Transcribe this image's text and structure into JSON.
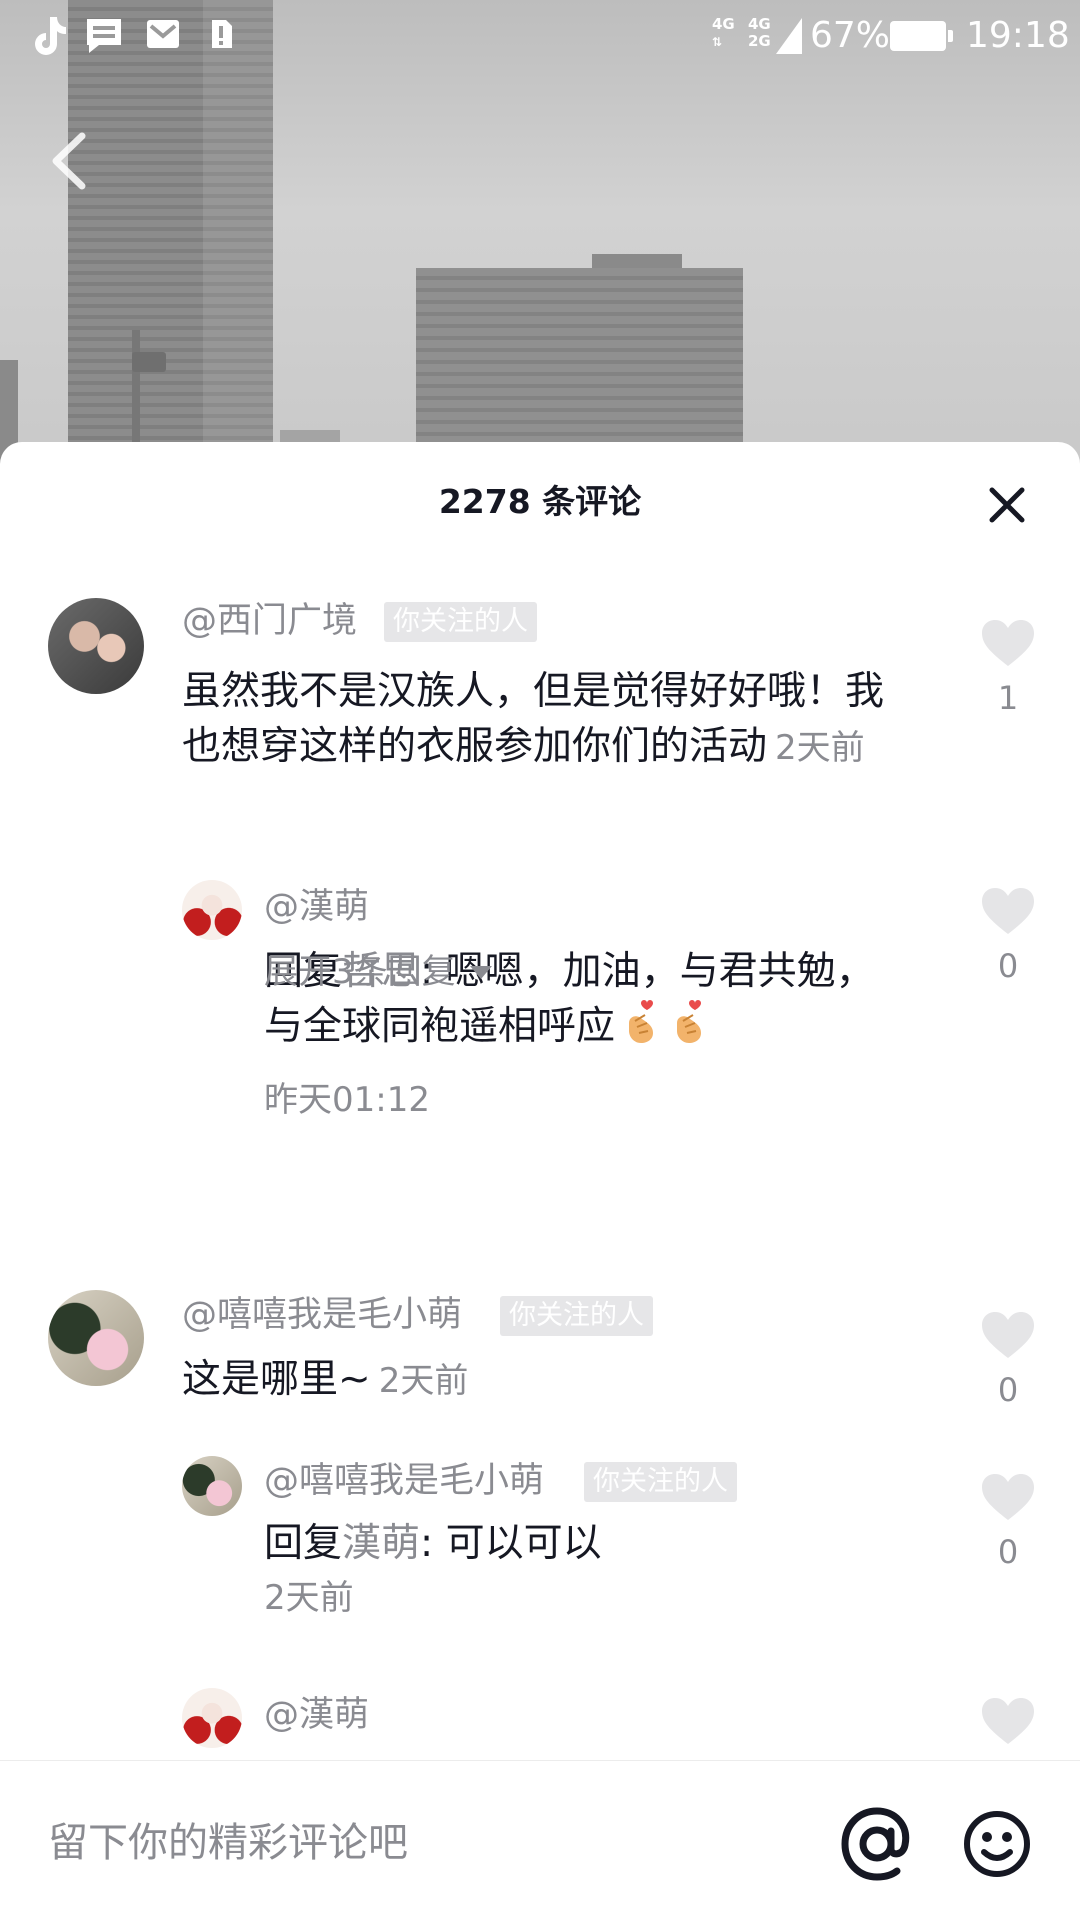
{
  "status_bar": {
    "network_1": "4G",
    "network_2": "4G",
    "network_2b": "2G",
    "battery": "67%",
    "time": "19:18"
  },
  "sheet": {
    "title": "2278 条评论"
  },
  "comments": [
    {
      "username": "@西门广境",
      "tag": "你关注的人",
      "text": "虽然我不是汉族人，但是觉得好好哦！我也想穿这样的衣服参加你们的活动",
      "time": "2天前",
      "likes": "1",
      "replies": [
        {
          "username": "@漢萌",
          "reply_prefix": "回复",
          "reply_target": "哲思",
          "text": ": 嗯嗯，加油，与君共勉，与全球同袍遥相呼应",
          "time": "昨天01:12",
          "likes": "0"
        }
      ],
      "expand_label": "展开3条回复"
    },
    {
      "username": "@嘻嘻我是毛小萌",
      "tag": "你关注的人",
      "text": "这是哪里~",
      "time": "2天前",
      "likes": "0",
      "replies": [
        {
          "username": "@嘻嘻我是毛小萌",
          "tag": "你关注的人",
          "reply_prefix": "回复",
          "reply_target": "漢萌",
          "text": ": 可以可以",
          "time": "2天前",
          "likes": "0"
        },
        {
          "username": "@漢萌"
        }
      ]
    }
  ],
  "input": {
    "placeholder": "留下你的精彩评论吧"
  },
  "icons": {
    "back": "back-arrow-icon",
    "close": "close-icon",
    "like": "heart-icon",
    "at": "at-icon",
    "emoji": "emoji-icon"
  }
}
